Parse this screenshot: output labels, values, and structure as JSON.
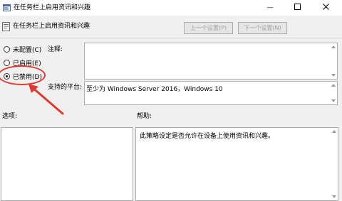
{
  "window": {
    "title": "在任务栏上启用资讯和兴趣",
    "minimize_glyph": "—",
    "maximize_glyph": "☐",
    "close_glyph": "✕"
  },
  "header": {
    "policy_name": "在任务栏上启用资讯和兴趣",
    "prev_button": "上一个设置(P)",
    "next_button": "下一个设置(N)"
  },
  "radios": {
    "not_configured": "未配置(C)",
    "enabled": "已启用(E)",
    "disabled": "已禁用(D)",
    "selected": "disabled"
  },
  "comment": {
    "label": "注释:",
    "value": ""
  },
  "supported_on": {
    "label": "支持的平台:",
    "value": "至少为 Windows Server 2016，Windows 10"
  },
  "options": {
    "label": "选项:"
  },
  "help": {
    "label": "帮助:",
    "text": "此策略设定是否允许在设备上使用资讯和兴趣。"
  },
  "annotation": {
    "color": "#e03a2f"
  }
}
